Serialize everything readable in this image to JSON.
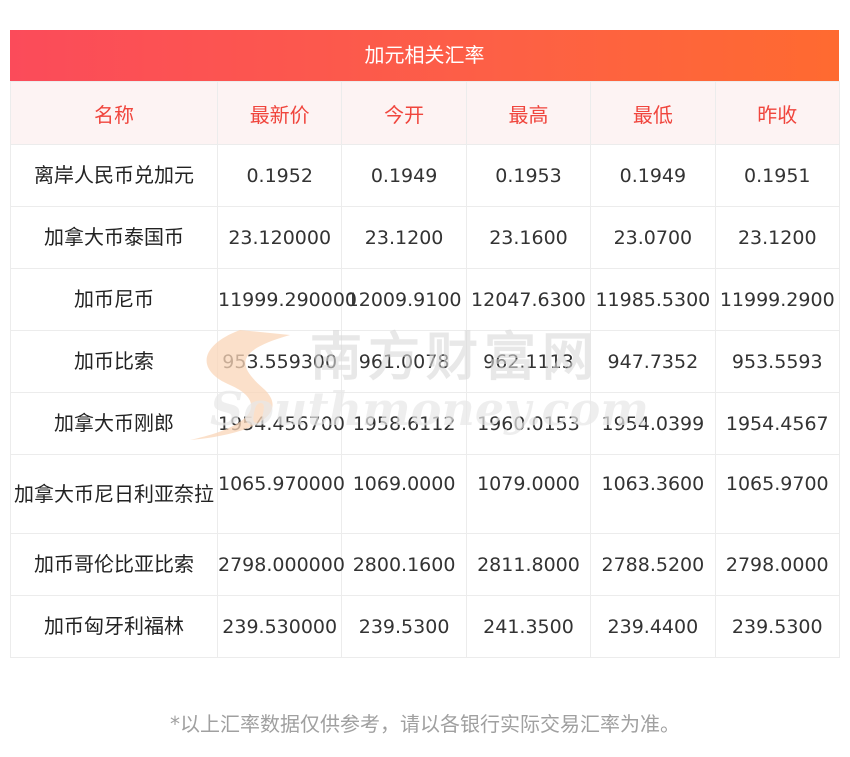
{
  "title": "加元相关汇率",
  "headers": [
    "名称",
    "最新价",
    "今开",
    "最高",
    "最低",
    "昨收"
  ],
  "rows": [
    {
      "name": "离岸人民币兑加元",
      "latest": "0.1952",
      "open": "0.1949",
      "high": "0.1953",
      "low": "0.1949",
      "prev_close": "0.1951"
    },
    {
      "name": "加拿大币泰国币",
      "latest": "23.120000",
      "open": "23.1200",
      "high": "23.1600",
      "low": "23.0700",
      "prev_close": "23.1200"
    },
    {
      "name": "加币尼币",
      "latest": "11999.290000",
      "open": "12009.9100",
      "high": "12047.6300",
      "low": "11985.5300",
      "prev_close": "11999.2900"
    },
    {
      "name": "加币比索",
      "latest": "953.559300",
      "open": "961.0078",
      "high": "962.1113",
      "low": "947.7352",
      "prev_close": "953.5593"
    },
    {
      "name": "加拿大币刚郎",
      "latest": "1954.456700",
      "open": "1958.6112",
      "high": "1960.0153",
      "low": "1954.0399",
      "prev_close": "1954.4567"
    },
    {
      "name": "加拿大币尼日利亚奈拉",
      "latest": "1065.970000",
      "open": "1069.0000",
      "high": "1079.0000",
      "low": "1063.3600",
      "prev_close": "1065.9700"
    },
    {
      "name": "加币哥伦比亚比索",
      "latest": "2798.000000",
      "open": "2800.1600",
      "high": "2811.8000",
      "low": "2788.5200",
      "prev_close": "2798.0000"
    },
    {
      "name": "加币匈牙利福林",
      "latest": "239.530000",
      "open": "239.5300",
      "high": "241.3500",
      "low": "239.4400",
      "prev_close": "239.5300"
    }
  ],
  "watermark": {
    "cn": "南方财富网",
    "en": "Southmoney.com"
  },
  "footnote": "*以上汇率数据仅供参考，请以各银行实际交易汇率为准。"
}
